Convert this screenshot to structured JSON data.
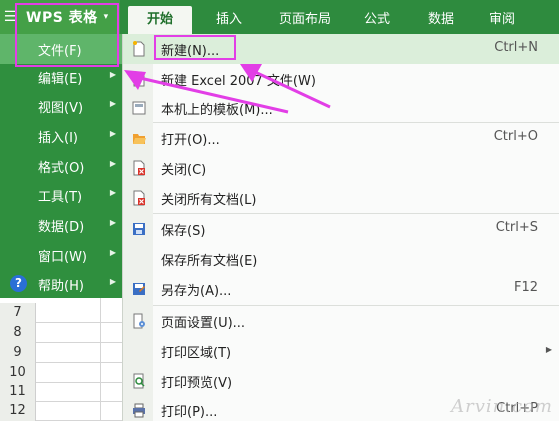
{
  "app": {
    "brand": "WPS 表格",
    "hamburger": "☰",
    "caret": "▾"
  },
  "tabs": [
    {
      "label": "开始",
      "active": true
    },
    {
      "label": "插入"
    },
    {
      "label": "页面布局"
    },
    {
      "label": "公式"
    },
    {
      "label": "数据"
    },
    {
      "label": "审阅"
    }
  ],
  "left_menu": [
    {
      "label": "文件(F)",
      "active": true
    },
    {
      "label": "编辑(E)"
    },
    {
      "label": "视图(V)"
    },
    {
      "label": "插入(I)"
    },
    {
      "label": "格式(O)"
    },
    {
      "label": "工具(T)"
    },
    {
      "label": "数据(D)"
    },
    {
      "label": "窗口(W)"
    },
    {
      "label": "帮助(H)"
    }
  ],
  "rows": [
    "7",
    "8",
    "9",
    "10",
    "11",
    "12"
  ],
  "file_menu": {
    "new": {
      "label": "新建(N)...",
      "shortcut": "Ctrl+N"
    },
    "new_excel2007": {
      "label": "新建 Excel 2007 文件(W)"
    },
    "templates": {
      "label": "本机上的模板(M)..."
    },
    "open": {
      "label": "打开(O)...",
      "shortcut": "Ctrl+O"
    },
    "close": {
      "label": "关闭(C)"
    },
    "close_all": {
      "label": "关闭所有文档(L)"
    },
    "save": {
      "label": "保存(S)",
      "shortcut": "Ctrl+S"
    },
    "save_all": {
      "label": "保存所有文档(E)"
    },
    "save_as": {
      "label": "另存为(A)...",
      "shortcut": "F12"
    },
    "page_setup": {
      "label": "页面设置(U)..."
    },
    "print_area": {
      "label": "打印区域(T)"
    },
    "print_preview": {
      "label": "打印预览(V)"
    },
    "print": {
      "label": "打印(P)...",
      "shortcut": "Ctrl+P"
    }
  },
  "watermark": "Arvin.com",
  "colors": {
    "accent_green": "#2e8b3e",
    "annotation": "#e23ee6",
    "highlight": "#dbeeda"
  }
}
